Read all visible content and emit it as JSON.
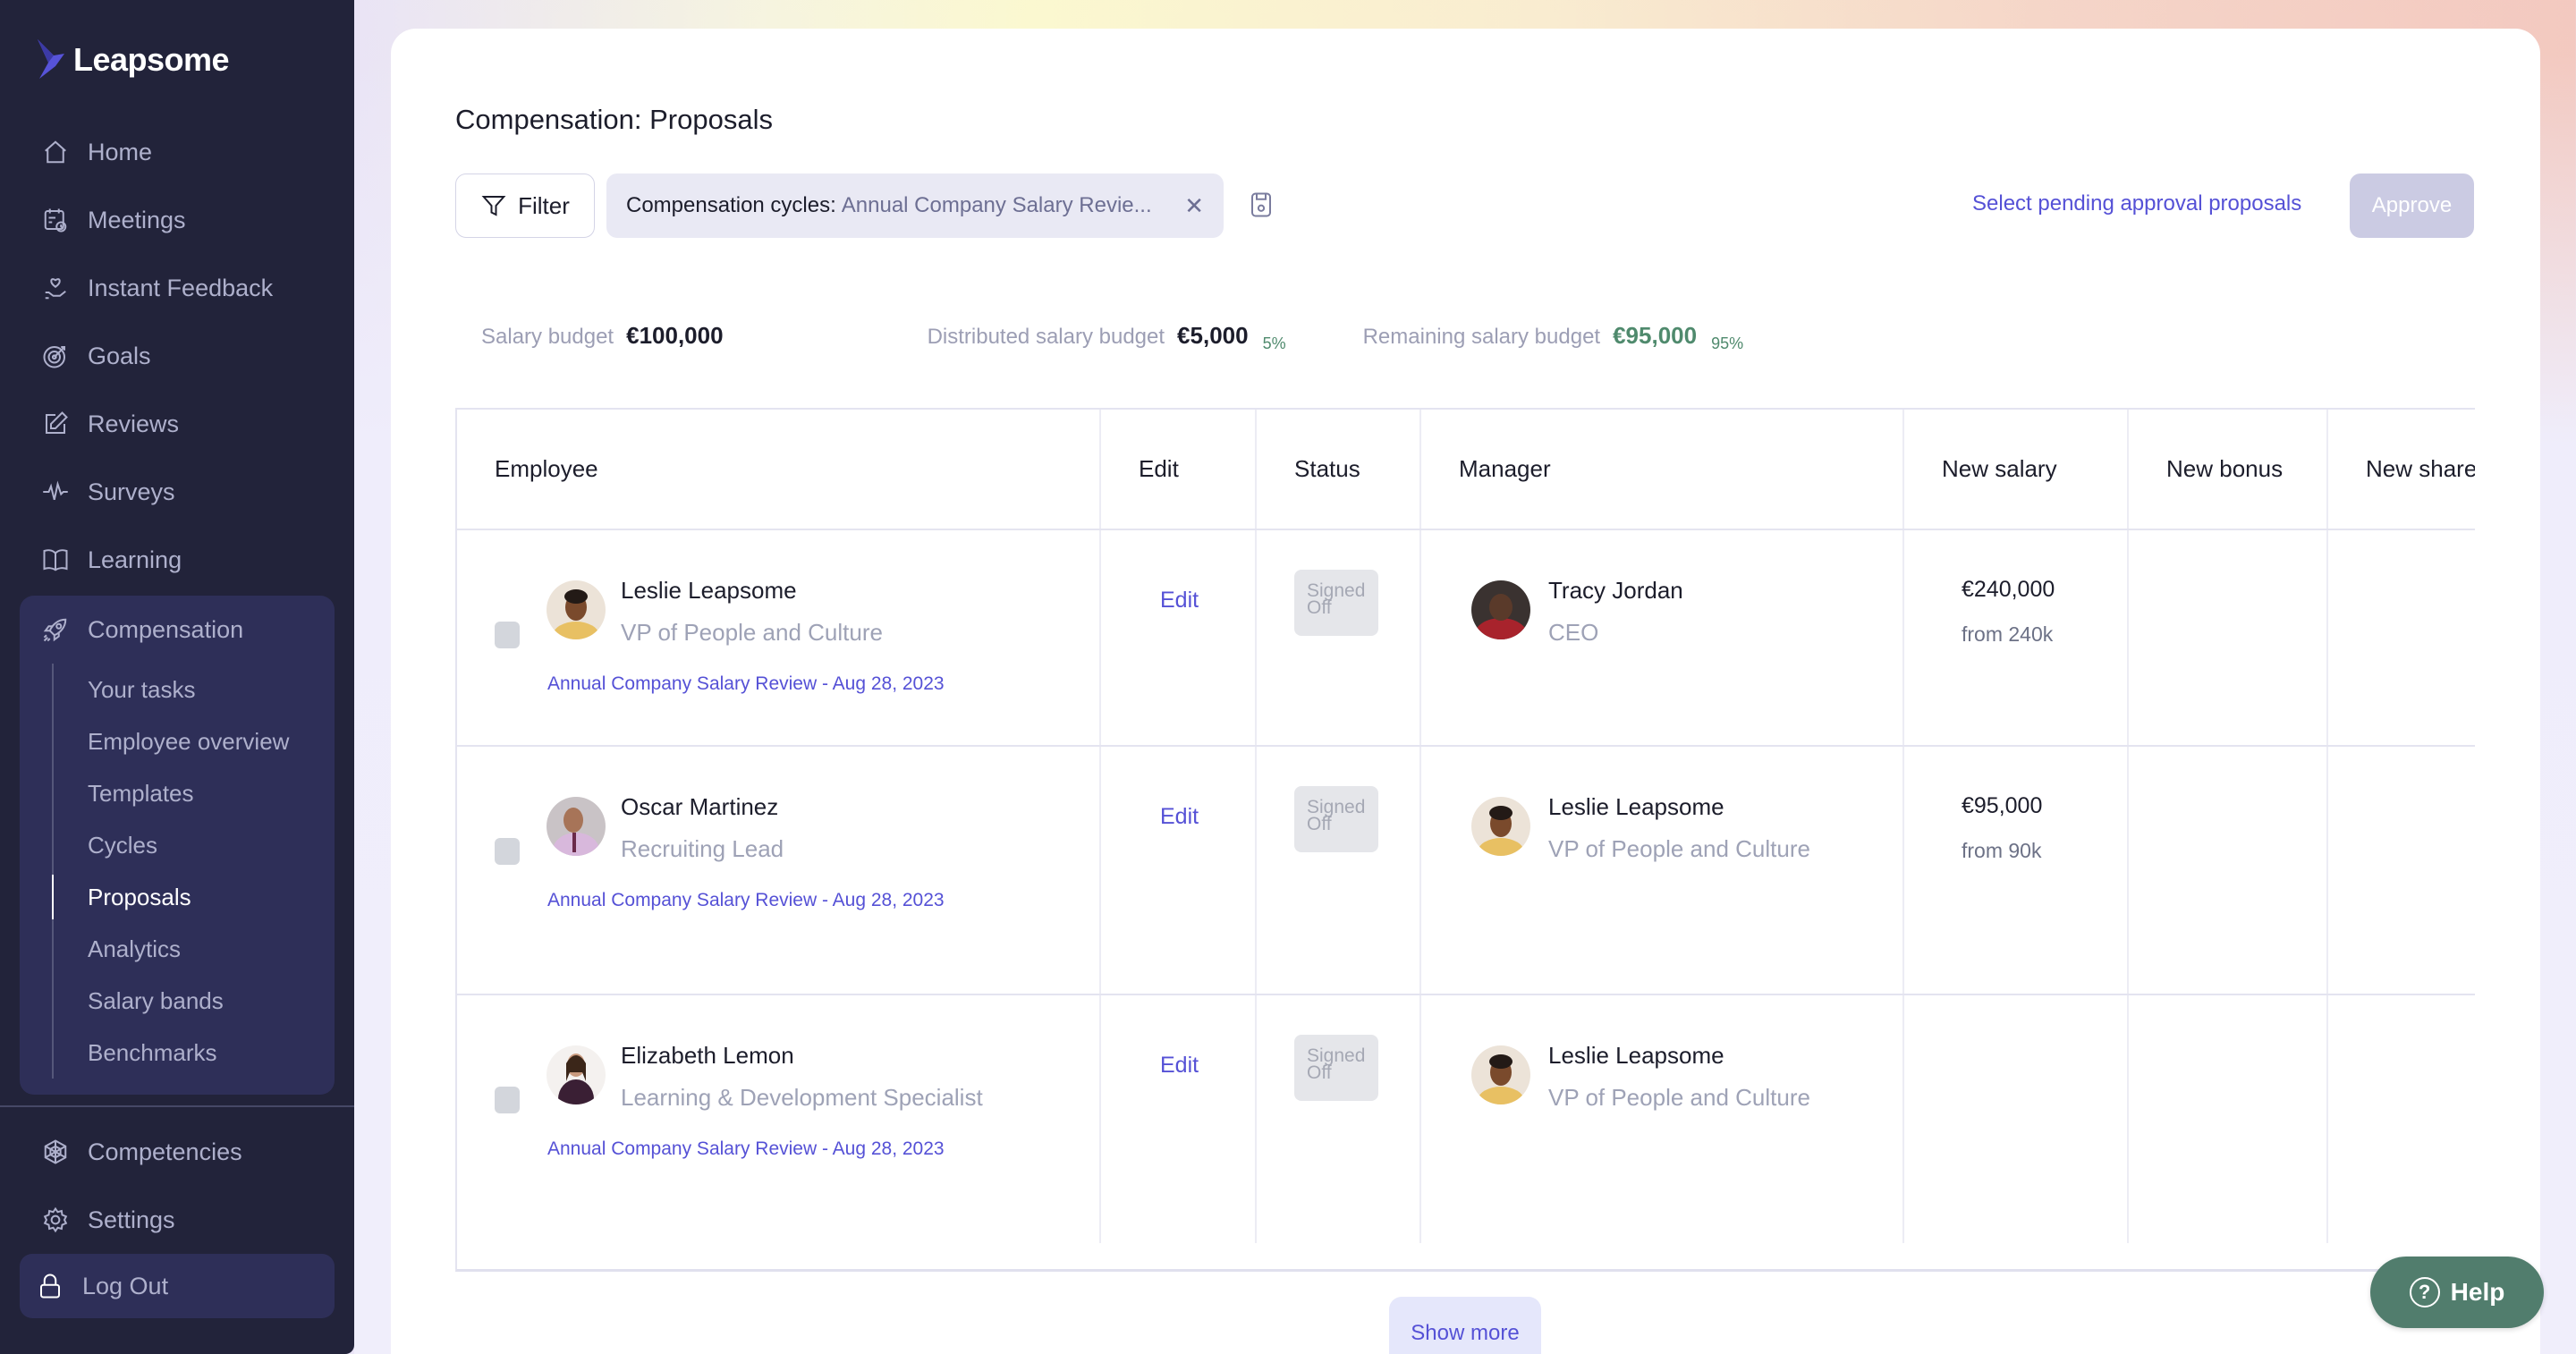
{
  "app": {
    "name": "Leapsome"
  },
  "sidebar": {
    "items": [
      {
        "label": "Home",
        "icon": "home-icon"
      },
      {
        "label": "Meetings",
        "icon": "calendar-clock-icon"
      },
      {
        "label": "Instant Feedback",
        "icon": "heart-hand-icon"
      },
      {
        "label": "Goals",
        "icon": "target-icon"
      },
      {
        "label": "Reviews",
        "icon": "edit-square-icon"
      },
      {
        "label": "Surveys",
        "icon": "pulse-icon"
      },
      {
        "label": "Learning",
        "icon": "book-icon"
      }
    ],
    "compensation": {
      "label": "Compensation",
      "icon": "rocket-icon",
      "subitems": [
        {
          "label": "Your tasks",
          "active": false
        },
        {
          "label": "Employee overview",
          "active": false
        },
        {
          "label": "Templates",
          "active": false
        },
        {
          "label": "Cycles",
          "active": false
        },
        {
          "label": "Proposals",
          "active": true
        },
        {
          "label": "Analytics",
          "active": false
        },
        {
          "label": "Salary bands",
          "active": false
        },
        {
          "label": "Benchmarks",
          "active": false
        }
      ]
    },
    "bottom_items": [
      {
        "label": "Competencies",
        "icon": "competencies-icon"
      },
      {
        "label": "Settings",
        "icon": "gear-icon"
      }
    ],
    "logout": {
      "label": "Log Out",
      "icon": "lock-icon"
    }
  },
  "page": {
    "title": "Compensation: Proposals",
    "filter_label": "Filter",
    "active_filter": {
      "label": "Compensation cycles:",
      "value": "Annual Company Salary Revie..."
    },
    "select_pending_label": "Select pending approval proposals",
    "approve_label": "Approve"
  },
  "budget": {
    "salary_budget": {
      "label": "Salary budget",
      "value": "€100,000"
    },
    "distributed": {
      "label": "Distributed salary budget",
      "value": "€5,000",
      "percent": "5%"
    },
    "remaining": {
      "label": "Remaining salary budget",
      "value": "€95,000",
      "percent": "95%"
    }
  },
  "table": {
    "columns": [
      "Employee",
      "Edit",
      "Status",
      "Manager",
      "New salary",
      "New bonus",
      "New share"
    ],
    "rows": [
      {
        "employee": {
          "name": "Leslie Leapsome",
          "role": "VP of People and Culture"
        },
        "cycle": "Annual Company Salary Review - Aug 28, 2023",
        "edit": "Edit",
        "status": "Signed Off",
        "manager": {
          "name": "Tracy Jordan",
          "role": "CEO"
        },
        "new_salary": "€240,000",
        "salary_from": "from 240k",
        "new_bonus": "",
        "new_share": ""
      },
      {
        "employee": {
          "name": "Oscar Martinez",
          "role": "Recruiting Lead"
        },
        "cycle": "Annual Company Salary Review - Aug 28, 2023",
        "edit": "Edit",
        "status": "Signed Off",
        "manager": {
          "name": "Leslie Leapsome",
          "role": "VP of People and Culture"
        },
        "new_salary": "€95,000",
        "salary_from": "from 90k",
        "new_bonus": "",
        "new_share": ""
      },
      {
        "employee": {
          "name": "Elizabeth Lemon",
          "role": "Learning & Development Specialist"
        },
        "cycle": "Annual Company Salary Review - Aug 28, 2023",
        "edit": "Edit",
        "status": "Signed Off",
        "manager": {
          "name": "Leslie Leapsome",
          "role": "VP of People and Culture"
        },
        "new_salary": "",
        "salary_from": "",
        "new_bonus": "",
        "new_share": ""
      }
    ]
  },
  "show_more_label": "Show more",
  "help_label": "Help",
  "colors": {
    "sidebar_bg": "#22233a",
    "sidebar_active_group": "#2e2f58",
    "accent": "#5551d6",
    "positive": "#4f8a6d",
    "help_bg": "#517d6d",
    "approve_disabled": "#cbcbe3"
  }
}
